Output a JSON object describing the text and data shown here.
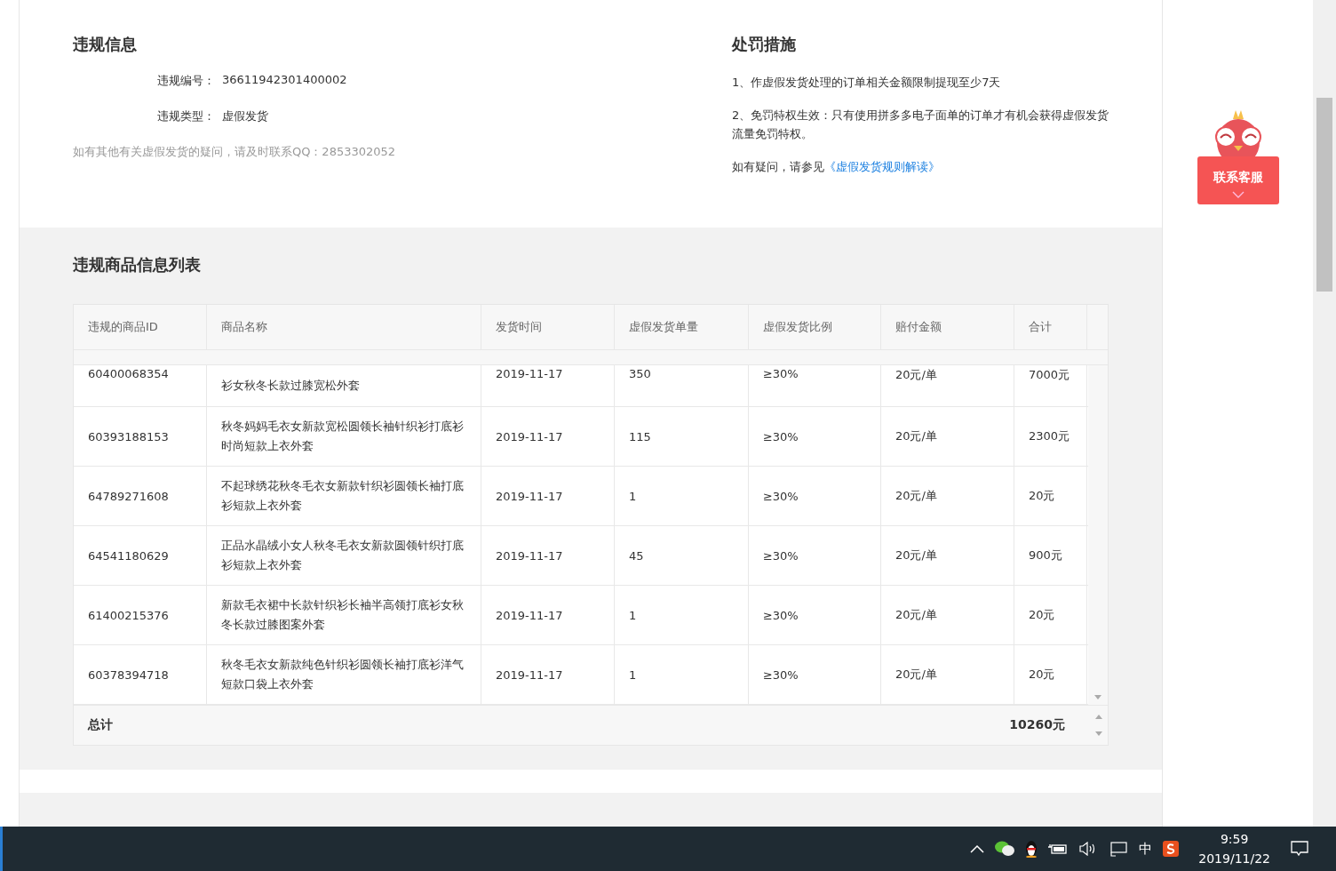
{
  "violation_info": {
    "title": "违规信息",
    "fields": [
      {
        "label": "违规编号：",
        "value": "36611942301400002"
      },
      {
        "label": "违规类型：",
        "value": "虚假发货"
      }
    ],
    "note": "如有其他有关虚假发货的疑问，请及时联系QQ：2853302052"
  },
  "penalty": {
    "title": "处罚措施",
    "items": [
      "1、作虚假发货处理的订单相关金额限制提现至少7天",
      "2、免罚特权生效：只有使用拼多多电子面单的订单才有机会获得虚假发货流量免罚特权。"
    ],
    "help_prefix": "如有疑问，请参见",
    "help_link": "《虚假发货规则解读》"
  },
  "product_list": {
    "title": "违规商品信息列表",
    "columns": [
      "违规的商品ID",
      "商品名称",
      "发货时间",
      "虚假发货单量",
      "虚假发货比例",
      "赔付金额",
      "合计"
    ],
    "rows": [
      {
        "id": "60400068354",
        "name": "衫女秋冬长款过膝宽松外套",
        "date": "2019-11-17",
        "qty": "350",
        "ratio": "≥30%",
        "fee": "20元/单",
        "total": "7000元",
        "cut_top": true
      },
      {
        "id": "60393188153",
        "name": "秋冬妈妈毛衣女新款宽松圆领长袖针织衫打底衫时尚短款上衣外套",
        "date": "2019-11-17",
        "qty": "115",
        "ratio": "≥30%",
        "fee": "20元/单",
        "total": "2300元",
        "cut_top": false
      },
      {
        "id": "64789271608",
        "name": "不起球绣花秋冬毛衣女新款针织衫圆领长袖打底衫短款上衣外套",
        "date": "2019-11-17",
        "qty": "1",
        "ratio": "≥30%",
        "fee": "20元/单",
        "total": "20元",
        "cut_top": false
      },
      {
        "id": "64541180629",
        "name": "正品水晶绒小女人秋冬毛衣女新款圆领针织打底衫短款上衣外套",
        "date": "2019-11-17",
        "qty": "45",
        "ratio": "≥30%",
        "fee": "20元/单",
        "total": "900元",
        "cut_top": false
      },
      {
        "id": "61400215376",
        "name": "新款毛衣裙中长款针织衫长袖半高领打底衫女秋冬长款过膝图案外套",
        "date": "2019-11-17",
        "qty": "1",
        "ratio": "≥30%",
        "fee": "20元/单",
        "total": "20元",
        "cut_top": false
      },
      {
        "id": "60378394718",
        "name": "秋冬毛衣女新款纯色针织衫圆领长袖打底衫洋气短款口袋上衣外套",
        "date": "2019-11-17",
        "qty": "1",
        "ratio": "≥30%",
        "fee": "20元/单",
        "total": "20元",
        "cut_top": false
      }
    ],
    "total_label": "总计",
    "total_value": "10260元"
  },
  "service_button": {
    "label": "联系客服"
  },
  "taskbar": {
    "ime": "中",
    "time": "9:59",
    "date": "2019/11/22"
  }
}
